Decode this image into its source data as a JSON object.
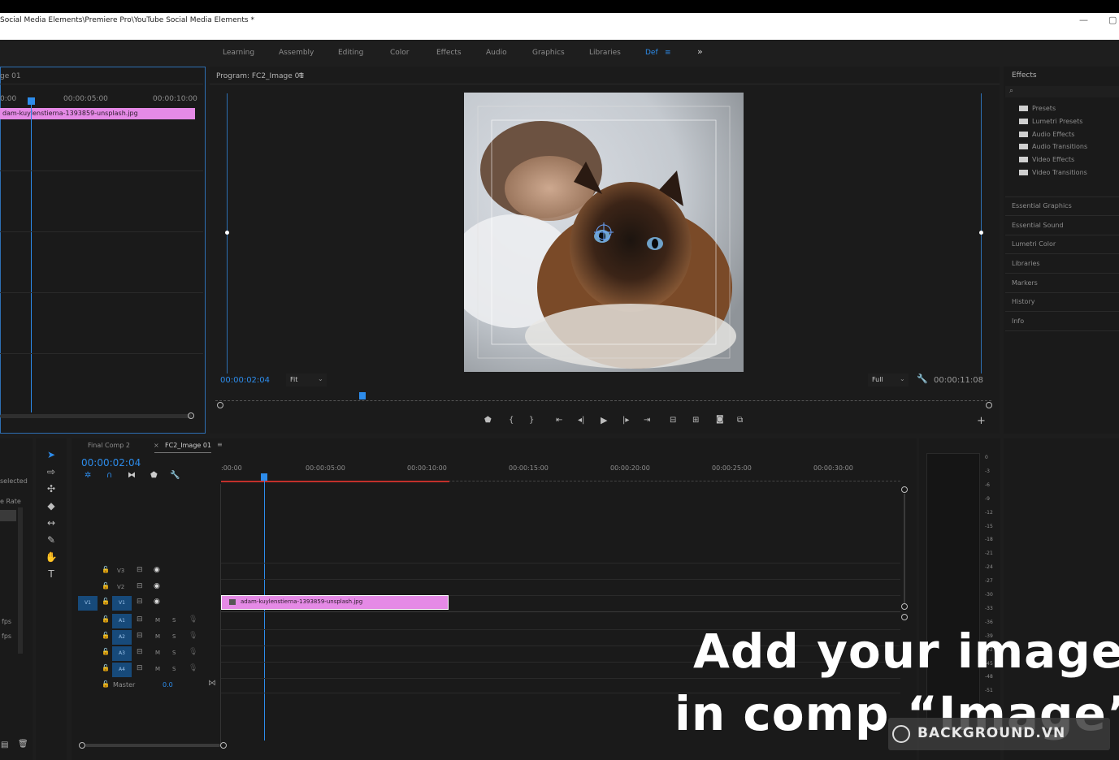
{
  "window": {
    "title": "Social Media Elements\\Premiere Pro\\YouTube Social Media Elements *",
    "minimize": "—",
    "restore": "▢"
  },
  "workspaces": {
    "tabs": [
      "Learning",
      "Assembly",
      "Editing",
      "Color",
      "Effects",
      "Audio",
      "Graphics",
      "Libraries",
      "Def"
    ],
    "active_menu": "≡",
    "more": "»"
  },
  "source_panel": {
    "title": "ge 01",
    "ruler": [
      "0:00",
      "00:00:05:00",
      "00:00:10:00"
    ],
    "clip": "dam-kuylenstierna-1393859-unsplash.jpg"
  },
  "program": {
    "title": "Program: FC2_Image 01",
    "menu": "≡",
    "timecode": "00:00:02:04",
    "fit": "Fit",
    "resolution": "Full",
    "duration": "00:00:11:08",
    "add": "+"
  },
  "effects_panel": {
    "title": "Effects",
    "items": [
      "Presets",
      "Lumetri Presets",
      "Audio Effects",
      "Audio Transitions",
      "Video Effects",
      "Video Transitions"
    ],
    "sections": [
      "Essential Graphics",
      "Essential Sound",
      "Lumetri Color",
      "Libraries",
      "Markers",
      "History",
      "Info"
    ]
  },
  "left_lower": {
    "labels": [
      "selected",
      "e Rate",
      "fps",
      "fps"
    ]
  },
  "timeline": {
    "tabs": [
      "Final Comp 2",
      "FC2_Image 01"
    ],
    "close": "×",
    "menu": "≡",
    "timecode": "00:00:02:04",
    "ruler": [
      ":00:00",
      "00:00:05:00",
      "00:00:10:00",
      "00:00:15:00",
      "00:00:20:00",
      "00:00:25:00",
      "00:00:30:00"
    ],
    "video_tracks": [
      "V3",
      "V2",
      "V1"
    ],
    "source_patch": "V1",
    "audio_tracks": [
      "A1",
      "A2",
      "A3",
      "A4"
    ],
    "mute": "M",
    "solo": "S",
    "master": "Master",
    "master_value": "0.0",
    "clip": "adam-kuylenstierna-1393859-unsplash.jpg"
  },
  "meter_scale": [
    "0",
    "-3",
    "-6",
    "-9",
    "-12",
    "-15",
    "-18",
    "-21",
    "-24",
    "-27",
    "-30",
    "-33",
    "-36",
    "-39",
    "-42",
    "-45",
    "-48",
    "-51"
  ],
  "overlay": {
    "line1": "Add your image",
    "line2": "in comp “Image”",
    "watermark": "BACKGROUND.VN"
  }
}
